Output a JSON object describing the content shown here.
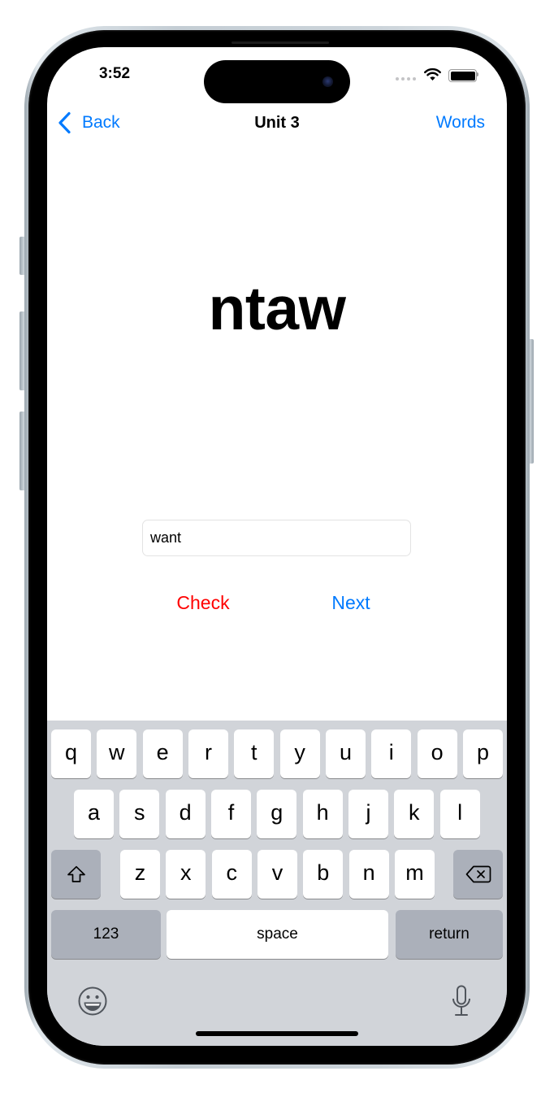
{
  "theme": {
    "accent": "#007AFF",
    "check": "#FF0000",
    "keyboard_background": "#D1D4D9",
    "function_key": "#ABB0BA"
  },
  "status_bar": {
    "time": "3:52",
    "icons": [
      "cellular-dots-icon",
      "wifi-icon",
      "battery-icon"
    ]
  },
  "nav": {
    "back_icon": "chevron-left-icon",
    "back_label": "Back",
    "title": "Unit 3",
    "words_label": "Words"
  },
  "main": {
    "scrambled_word": "ntaw",
    "answer_input": {
      "value": "want"
    },
    "check_label": "Check",
    "next_label": "Next"
  },
  "keyboard": {
    "rows": [
      [
        "q",
        "w",
        "e",
        "r",
        "t",
        "y",
        "u",
        "i",
        "o",
        "p"
      ],
      [
        "a",
        "s",
        "d",
        "f",
        "g",
        "h",
        "j",
        "k",
        "l"
      ],
      [
        "z",
        "x",
        "c",
        "v",
        "b",
        "n",
        "m"
      ]
    ],
    "shift_icon": "shift-arrow-icon",
    "delete_icon": "delete-backspace-icon",
    "numbers_label": "123",
    "space_label": "space",
    "return_label": "return",
    "emoji_icon": "emoji-smiley-icon",
    "dictation_icon": "microphone-icon"
  }
}
